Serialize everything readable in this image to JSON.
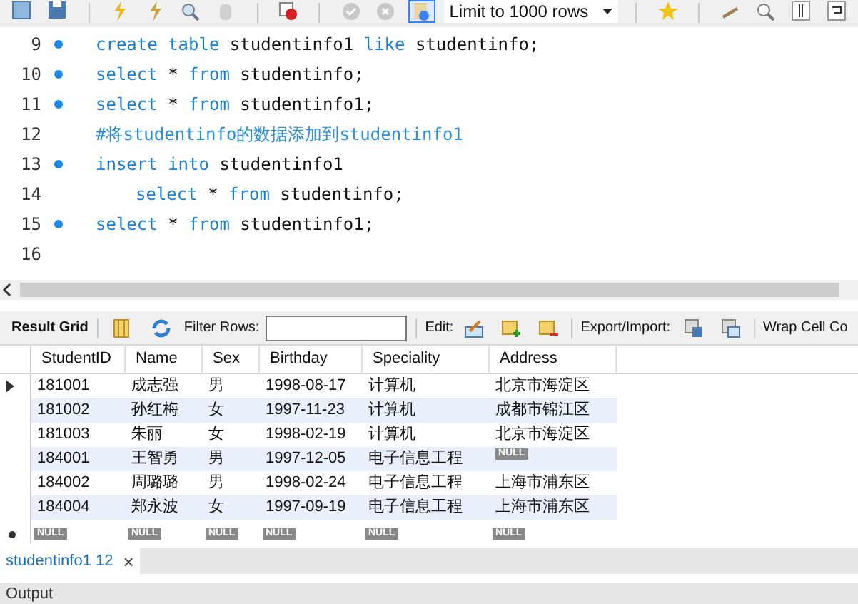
{
  "toolbar": {
    "limit_select": "Limit to 1000 rows"
  },
  "editor": {
    "lines": [
      {
        "number": "9",
        "marker": true,
        "indent": false,
        "tokens": [
          {
            "text": "create table",
            "kind": "keyword"
          },
          {
            "text": "studentinfo1",
            "kind": "plain"
          },
          {
            "text": "like",
            "kind": "keyword"
          },
          {
            "text": "studentinfo;",
            "kind": "plain"
          }
        ]
      },
      {
        "number": "10",
        "marker": true,
        "indent": false,
        "tokens": [
          {
            "text": "select",
            "kind": "keyword"
          },
          {
            "text": "*",
            "kind": "plain"
          },
          {
            "text": "from",
            "kind": "keyword"
          },
          {
            "text": "studentinfo;",
            "kind": "plain"
          }
        ]
      },
      {
        "number": "11",
        "marker": true,
        "indent": false,
        "tokens": [
          {
            "text": "select",
            "kind": "keyword"
          },
          {
            "text": "*",
            "kind": "plain"
          },
          {
            "text": "from",
            "kind": "keyword"
          },
          {
            "text": "studentinfo1;",
            "kind": "plain"
          }
        ]
      },
      {
        "number": "12",
        "marker": false,
        "indent": false,
        "tokens": [
          {
            "text": "#将studentinfo的数据添加到studentinfo1",
            "kind": "comment"
          }
        ]
      },
      {
        "number": "13",
        "marker": true,
        "indent": false,
        "tokens": [
          {
            "text": "insert into",
            "kind": "keyword"
          },
          {
            "text": "studentinfo1",
            "kind": "plain"
          }
        ]
      },
      {
        "number": "14",
        "marker": false,
        "indent": true,
        "tokens": [
          {
            "text": "select",
            "kind": "keyword"
          },
          {
            "text": "*",
            "kind": "plain"
          },
          {
            "text": "from",
            "kind": "keyword"
          },
          {
            "text": "studentinfo;",
            "kind": "plain"
          }
        ]
      },
      {
        "number": "15",
        "marker": true,
        "indent": false,
        "tokens": [
          {
            "text": "select",
            "kind": "keyword"
          },
          {
            "text": "*",
            "kind": "plain"
          },
          {
            "text": "from",
            "kind": "keyword"
          },
          {
            "text": "studentinfo1;",
            "kind": "plain"
          }
        ]
      },
      {
        "number": "16",
        "marker": false
      }
    ]
  },
  "result_toolbar": {
    "title": "Result Grid",
    "filter_label": "Filter Rows:",
    "edit_label": "Edit:",
    "export_label": "Export/Import:",
    "wrap_label": "Wrap Cell Co"
  },
  "table": {
    "columns": [
      "StudentID",
      "Name",
      "Sex",
      "Birthday",
      "Speciality",
      "Address"
    ],
    "rows": [
      {
        "current": true,
        "cells": [
          {
            "kind": "value",
            "text": "181001"
          },
          {
            "kind": "value",
            "text": "成志强"
          },
          {
            "kind": "value",
            "text": "男"
          },
          {
            "kind": "value",
            "text": "1998-08-17"
          },
          {
            "kind": "value",
            "text": "计算机"
          },
          {
            "kind": "value",
            "text": "北京市海淀区"
          }
        ]
      },
      {
        "current": false,
        "cells": [
          {
            "kind": "value",
            "text": "181002"
          },
          {
            "kind": "value",
            "text": "孙红梅"
          },
          {
            "kind": "value",
            "text": "女"
          },
          {
            "kind": "value",
            "text": "1997-11-23"
          },
          {
            "kind": "value",
            "text": "计算机"
          },
          {
            "kind": "value",
            "text": "成都市锦江区"
          }
        ]
      },
      {
        "current": false,
        "cells": [
          {
            "kind": "value",
            "text": "181003"
          },
          {
            "kind": "value",
            "text": "朱丽"
          },
          {
            "kind": "value",
            "text": "女"
          },
          {
            "kind": "value",
            "text": "1998-02-19"
          },
          {
            "kind": "value",
            "text": "计算机"
          },
          {
            "kind": "value",
            "text": "北京市海淀区"
          }
        ]
      },
      {
        "current": false,
        "cells": [
          {
            "kind": "value",
            "text": "184001"
          },
          {
            "kind": "value",
            "text": "王智勇"
          },
          {
            "kind": "value",
            "text": "男"
          },
          {
            "kind": "value",
            "text": "1997-12-05"
          },
          {
            "kind": "value",
            "text": "电子信息工程"
          },
          {
            "kind": "null",
            "text": "NULL"
          }
        ]
      },
      {
        "current": false,
        "cells": [
          {
            "kind": "value",
            "text": "184002"
          },
          {
            "kind": "value",
            "text": "周璐璐"
          },
          {
            "kind": "value",
            "text": "男"
          },
          {
            "kind": "value",
            "text": "1998-02-24"
          },
          {
            "kind": "value",
            "text": "电子信息工程"
          },
          {
            "kind": "value",
            "text": "上海市浦东区"
          }
        ]
      },
      {
        "current": false,
        "cells": [
          {
            "kind": "value",
            "text": "184004"
          },
          {
            "kind": "value",
            "text": "郑永波"
          },
          {
            "kind": "value",
            "text": "女"
          },
          {
            "kind": "value",
            "text": "1997-09-19"
          },
          {
            "kind": "value",
            "text": "电子信息工程"
          },
          {
            "kind": "value",
            "text": "上海市浦东区"
          }
        ]
      }
    ],
    "new_row": [
      "NULL",
      "NULL",
      "NULL",
      "NULL",
      "NULL",
      "NULL"
    ]
  },
  "result_tabs": [
    {
      "label": "studentinfo1 12",
      "close": "×",
      "selected": true
    }
  ],
  "output_panel": {
    "title": "Output"
  }
}
